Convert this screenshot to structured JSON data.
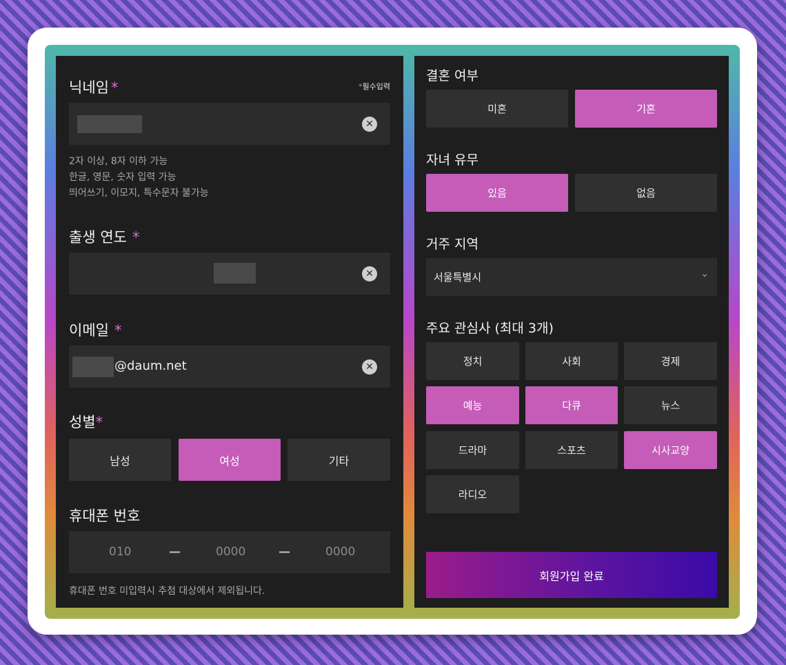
{
  "left": {
    "nickname": {
      "label": "닉네임",
      "required_mark": "*",
      "required_note_star": "*",
      "required_note": "필수입력",
      "hints": [
        "2자 이상, 8자 이하 가능",
        "한글, 영문, 숫자 입력 가능",
        "띄어쓰기, 이모지, 특수문자 불가능"
      ],
      "clear_icon": "clear-icon"
    },
    "birth_year": {
      "label": "출생 연도",
      "required_mark": "*"
    },
    "email": {
      "label": "이메일",
      "required_mark": "*",
      "domain": "@daum.net"
    },
    "gender": {
      "label": "성별",
      "required_mark": "*",
      "options": [
        "남성",
        "여성",
        "기타"
      ],
      "selected": "여성"
    },
    "phone": {
      "label": "휴대폰 번호",
      "part1": "010",
      "part2": "0000",
      "part3": "0000",
      "dash": "—",
      "note": "휴대폰 번호 미입력시 추첨 대상에서 제외됩니다."
    }
  },
  "right": {
    "marriage": {
      "label": "결혼 여부",
      "options": [
        "미혼",
        "기혼"
      ],
      "selected": "기혼"
    },
    "children": {
      "label": "자녀 유무",
      "options": [
        "있음",
        "없음"
      ],
      "selected": "있음"
    },
    "region": {
      "label": "거주 지역",
      "value": "서울특별시",
      "chevron": "⌄"
    },
    "interests": {
      "label": "주요 관심사 (최대 3개)",
      "options": [
        "정치",
        "사회",
        "경제",
        "예능",
        "다큐",
        "뉴스",
        "드라마",
        "스포츠",
        "시사교양",
        "라디오"
      ],
      "selected": [
        "예능",
        "다큐",
        "시사교양"
      ]
    },
    "submit_label": "회원가입 완료"
  },
  "colors": {
    "accent": "#c45cb8",
    "required": "#d870c8",
    "panel_bg": "#1e1e1e",
    "field_bg": "#2c2c2c"
  }
}
